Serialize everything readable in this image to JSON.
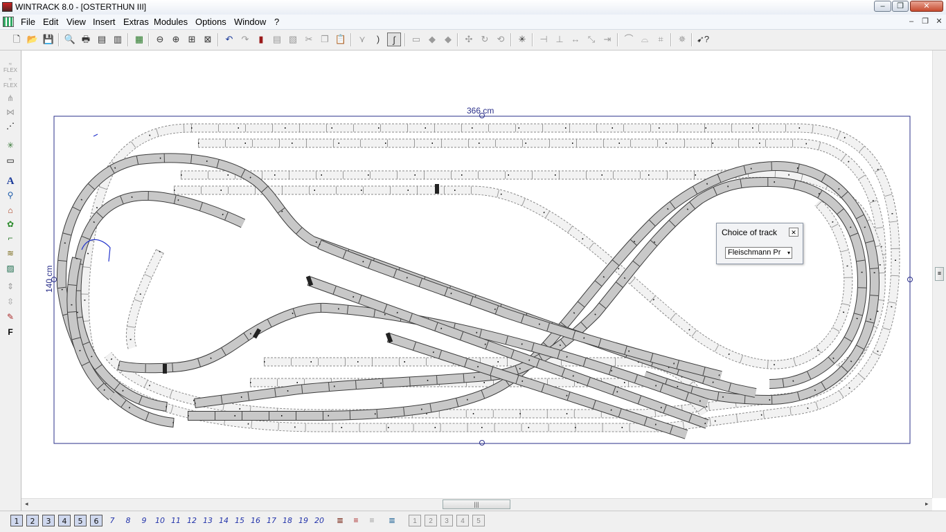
{
  "window": {
    "title": "WINTRACK 8.0 - [OSTERTHUN III]",
    "min": "‒",
    "restore": "❐",
    "close": "✕"
  },
  "menu": {
    "items": [
      "File",
      "Edit",
      "View",
      "Insert",
      "Extras",
      "Modules",
      "Options",
      "Window",
      "?"
    ],
    "mdi_min": "‒",
    "mdi_restore": "❐",
    "mdi_close": "✕"
  },
  "toolbar": {
    "icons": [
      "new-file-icon",
      "open-folder-icon",
      "save-icon",
      "print-preview-icon",
      "print-icon",
      "print-setup-icon",
      "page-list-icon",
      "image-icon",
      "zoom-out-icon",
      "zoom-in-icon",
      "zoom-window-icon",
      "zoom-fit-icon",
      "undo-icon",
      "redo-icon",
      "book-icon",
      "copy-sheet-icon",
      "paste-sheet-icon",
      "cut-icon",
      "copy-icon",
      "paste-icon",
      "turnout-icon",
      "curve-icon",
      "flex-track-icon",
      "layer-a-icon",
      "layer-b-icon",
      "layer-c-icon",
      "connect-icon",
      "rotate-icon",
      "rotate-180-icon",
      "insert-mark-icon",
      "align-icon",
      "split-icon",
      "join-icon",
      "move-icon",
      "move-right-icon",
      "bridge-icon",
      "gap-icon",
      "height-icon",
      "explode-icon",
      "help-pointer-icon"
    ]
  },
  "left_toolbar": {
    "labels": [
      "FLEX",
      "FLEX"
    ]
  },
  "drawing": {
    "width_label": "366 cm",
    "height_label": "140 cm",
    "colors": {
      "track_fill": "#c8c8c8",
      "track_edge": "#3a3a3a",
      "ghost_edge": "#8a8a8a",
      "frame": "#2a2f8a",
      "dim_text": "#2a2f8a"
    }
  },
  "choice_dialog": {
    "title": "Choice of track",
    "close": "✕",
    "selected": "Fleischmann Pr",
    "caret": "▾"
  },
  "scroll": {
    "hthumb": "|||",
    "vthumb": "≡",
    "left": "◂",
    "right": "▸"
  },
  "layers": [
    {
      "label": "1",
      "state": "on"
    },
    {
      "label": "2",
      "state": "on"
    },
    {
      "label": "3",
      "state": "on"
    },
    {
      "label": "4",
      "state": "on"
    },
    {
      "label": "5",
      "state": "on"
    },
    {
      "label": "6",
      "state": "on"
    },
    {
      "label": "7",
      "state": "off"
    },
    {
      "label": "8",
      "state": "off"
    },
    {
      "label": "9",
      "state": "off"
    },
    {
      "label": "10",
      "state": "off"
    },
    {
      "label": "11",
      "state": "off"
    },
    {
      "label": "12",
      "state": "off"
    },
    {
      "label": "13",
      "state": "off"
    },
    {
      "label": "14",
      "state": "off"
    },
    {
      "label": "15",
      "state": "off"
    },
    {
      "label": "16",
      "state": "off"
    },
    {
      "label": "17",
      "state": "off"
    },
    {
      "label": "18",
      "state": "off"
    },
    {
      "label": "19",
      "state": "off"
    },
    {
      "label": "20",
      "state": "off"
    }
  ],
  "bottom_right": [
    "1",
    "2",
    "3",
    "4",
    "5"
  ]
}
